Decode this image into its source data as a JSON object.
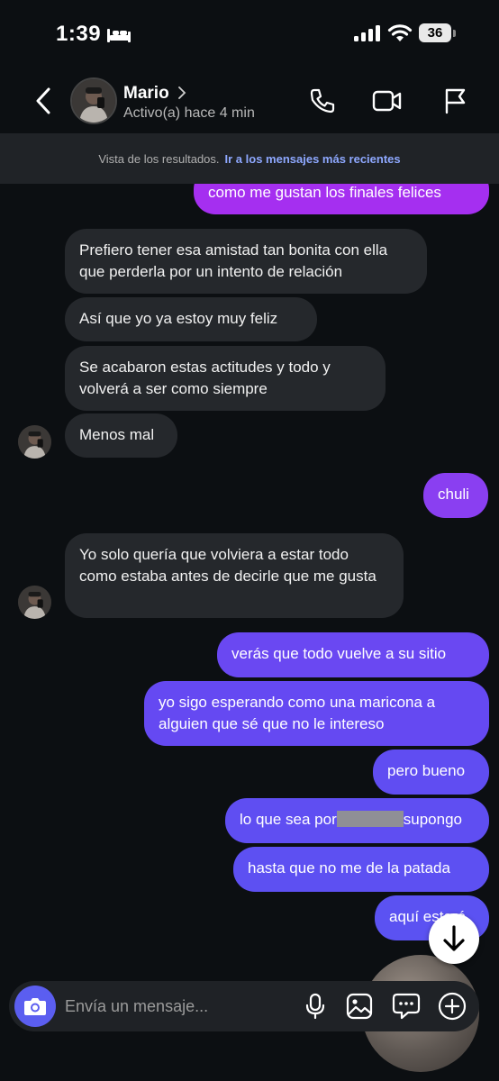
{
  "status_bar": {
    "time": "1:39",
    "battery": "36"
  },
  "header": {
    "name": "Mario",
    "status": "Activo(a) hace 4 min",
    "icons": [
      "back-icon",
      "phone-icon",
      "video-icon",
      "flag-icon"
    ]
  },
  "banner": {
    "text": "Vista de los resultados.",
    "link": "Ir a los mensajes más recientes"
  },
  "messages": [
    {
      "from": "me",
      "text": "como me gustan los finales felices"
    },
    {
      "from": "them",
      "text": "Prefiero tener esa amistad tan bonita con ella que perderla por un intento de relación"
    },
    {
      "from": "them",
      "text": "Así que yo ya estoy muy feliz"
    },
    {
      "from": "them",
      "text": "Se acabaron estas actitudes y todo y volverá a ser como siempre"
    },
    {
      "from": "them",
      "text": "Menos mal"
    },
    {
      "from": "me",
      "text": "chuli"
    },
    {
      "from": "them",
      "text": "Yo solo quería que volviera a estar todo como estaba antes de decirle que me gusta"
    },
    {
      "from": "me",
      "text": "verás que todo vuelve a su sitio"
    },
    {
      "from": "me",
      "text": "yo sigo esperando como una maricona a alguien que sé que no le intereso"
    },
    {
      "from": "me",
      "text": "pero bueno"
    },
    {
      "from": "me",
      "text_before": "lo que sea por",
      "text_after": "supongo"
    },
    {
      "from": "me",
      "text": "hasta que no me de la patada"
    },
    {
      "from": "me",
      "text": "aquí estaré"
    }
  ],
  "composer": {
    "placeholder": "Envía un mensaje...",
    "icons": [
      "camera-icon",
      "microphone-icon",
      "image-icon",
      "sticker-icon",
      "plus-icon"
    ]
  },
  "colors": {
    "background": "#0c0f12",
    "incoming_bubble": "#25282c",
    "outgoing_top": "#a52ff0",
    "outgoing_bottom": "#5d52f2",
    "link": "#8ea8ff"
  }
}
